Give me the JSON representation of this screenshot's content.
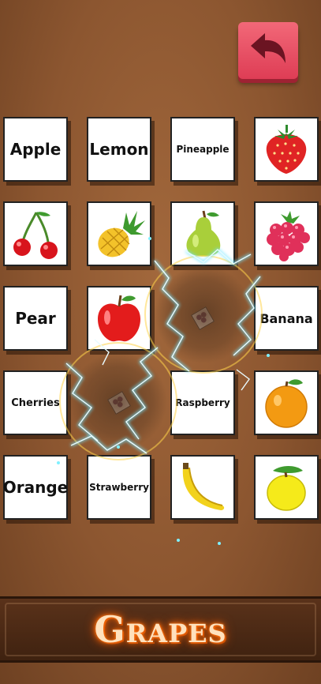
{
  "back_button": {
    "icon": "back-arrow-icon",
    "color": "#e84a5f"
  },
  "cards": [
    {
      "row": 0,
      "col": 0,
      "kind": "word",
      "label": "Apple",
      "size": "lg"
    },
    {
      "row": 0,
      "col": 1,
      "kind": "word",
      "label": "Lemon",
      "size": "lg"
    },
    {
      "row": 0,
      "col": 2,
      "kind": "word",
      "label": "Pineapple",
      "size": "xs"
    },
    {
      "row": 0,
      "col": 3,
      "kind": "image",
      "icon": "strawberry-icon"
    },
    {
      "row": 1,
      "col": 0,
      "kind": "image",
      "icon": "cherries-icon"
    },
    {
      "row": 1,
      "col": 1,
      "kind": "image",
      "icon": "pineapple-icon"
    },
    {
      "row": 1,
      "col": 2,
      "kind": "image",
      "icon": "pear-icon"
    },
    {
      "row": 1,
      "col": 3,
      "kind": "image",
      "icon": "raspberry-icon"
    },
    {
      "row": 2,
      "col": 0,
      "kind": "word",
      "label": "Pear",
      "size": "lg"
    },
    {
      "row": 2,
      "col": 1,
      "kind": "image",
      "icon": "apple-icon"
    },
    {
      "row": 2,
      "col": 2,
      "kind": "matched",
      "icon": "grapes-icon"
    },
    {
      "row": 2,
      "col": 3,
      "kind": "word",
      "label": "Banana",
      "size": "md"
    },
    {
      "row": 3,
      "col": 0,
      "kind": "word",
      "label": "Cherries",
      "size": "sm"
    },
    {
      "row": 3,
      "col": 1,
      "kind": "matched",
      "icon": "grapes-icon"
    },
    {
      "row": 3,
      "col": 2,
      "kind": "word",
      "label": "Raspberry",
      "size": "xs"
    },
    {
      "row": 3,
      "col": 3,
      "kind": "image",
      "icon": "orange-icon"
    },
    {
      "row": 4,
      "col": 0,
      "kind": "word",
      "label": "Orange",
      "size": "lg"
    },
    {
      "row": 4,
      "col": 1,
      "kind": "word",
      "label": "Strawberry",
      "size": "xs"
    },
    {
      "row": 4,
      "col": 2,
      "kind": "image",
      "icon": "banana-icon"
    },
    {
      "row": 4,
      "col": 3,
      "kind": "image",
      "icon": "lemon-icon"
    }
  ],
  "target_word": "Grapes"
}
